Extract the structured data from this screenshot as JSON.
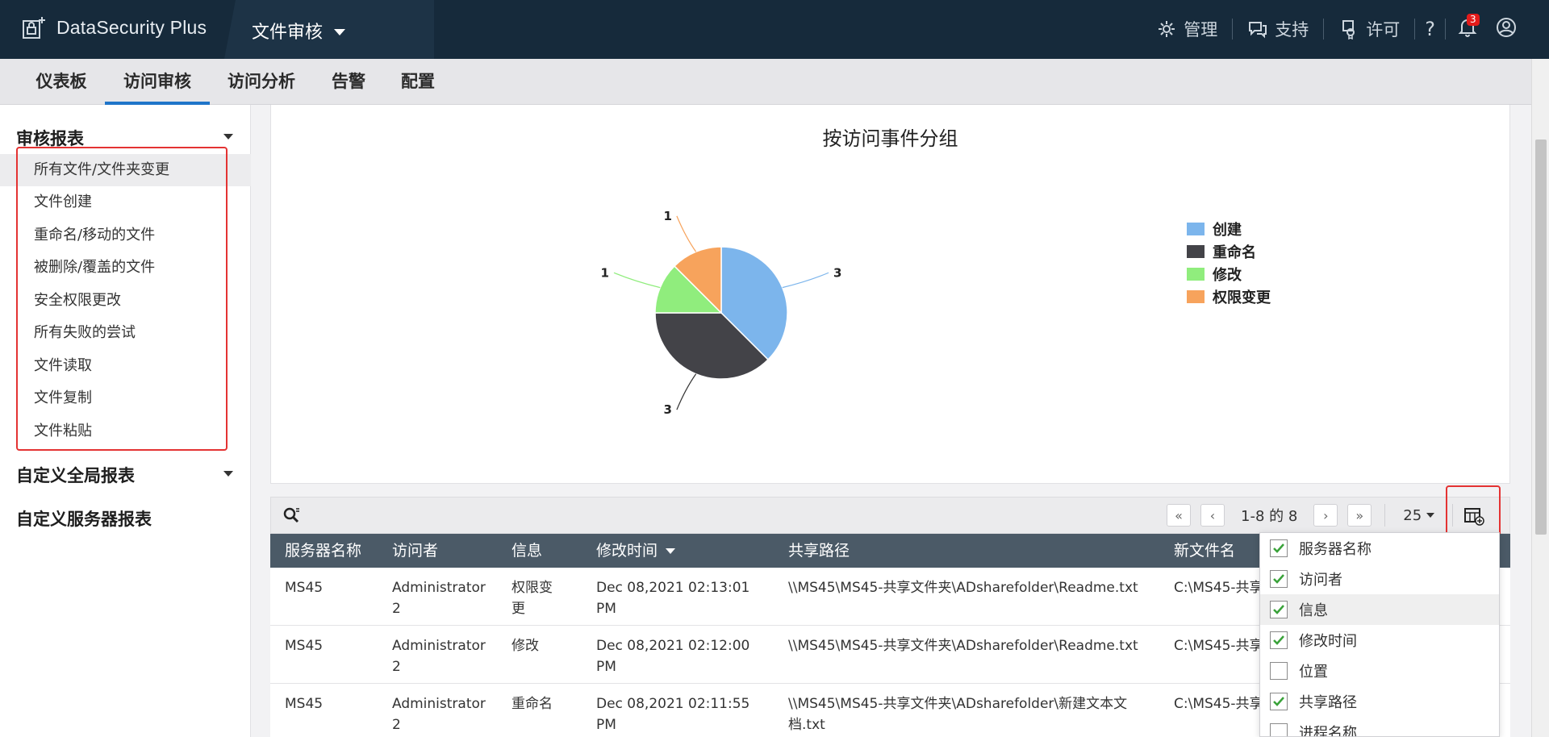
{
  "brand": {
    "name": "DataSecurity Plus"
  },
  "module": {
    "label": "文件审核"
  },
  "top_actions": {
    "admin": "管理",
    "support": "支持",
    "license": "许可",
    "help": "?",
    "notifications": "3"
  },
  "nav": {
    "tabs": [
      "仪表板",
      "访问审核",
      "访问分析",
      "告警",
      "配置"
    ],
    "active": "访问审核"
  },
  "sidebar": {
    "audit_reports": "审核报表",
    "items": [
      "所有文件/文件夹变更",
      "文件创建",
      "重命名/移动的文件",
      "被删除/覆盖的文件",
      "安全权限更改",
      "所有失败的尝试",
      "文件读取",
      "文件复制",
      "文件粘贴"
    ],
    "custom_global": "自定义全局报表",
    "custom_server": "自定义服务器报表"
  },
  "chart_data": {
    "type": "pie",
    "title": "按访问事件分组",
    "categories": [
      "创建",
      "重命名",
      "修改",
      "权限变更"
    ],
    "values": [
      3,
      3,
      1,
      1
    ],
    "colors": [
      "#7cb5ec",
      "#434348",
      "#90ed7d",
      "#f7a35c"
    ],
    "legend": "right"
  },
  "pager": {
    "range": "1-8 的 8",
    "per_page": "25",
    "first": "«",
    "prev": "‹",
    "next": "›",
    "last": "»"
  },
  "table": {
    "headers": [
      "服务器名称",
      "访问者",
      "信息",
      "修改时间",
      "共享路径",
      "新文件名"
    ],
    "rows": [
      {
        "server": "MS45",
        "user_line1": "Administrator",
        "user_line2": "2",
        "info_line1": "权限变",
        "info_line2": "更",
        "time_line1": "Dec 08,2021 02:13:01",
        "time_line2": "PM",
        "path_line1": "\\\\MS45\\MS45-共享文件夹\\ADsharefolder\\Readme.txt",
        "path_line2": "",
        "newname": "C:\\MS45-共享"
      },
      {
        "server": "MS45",
        "user_line1": "Administrator",
        "user_line2": "2",
        "info_line1": "修改",
        "info_line2": "",
        "time_line1": "Dec 08,2021 02:12:00",
        "time_line2": "PM",
        "path_line1": "\\\\MS45\\MS45-共享文件夹\\ADsharefolder\\Readme.txt",
        "path_line2": "",
        "newname": "C:\\MS45-共享"
      },
      {
        "server": "MS45",
        "user_line1": "Administrator",
        "user_line2": "2",
        "info_line1": "重命名",
        "info_line2": "",
        "time_line1": "Dec 08,2021 02:11:55",
        "time_line2": "PM",
        "path_line1": "\\\\MS45\\MS45-共享文件夹\\ADsharefolder\\新建文本文",
        "path_line2": "档.txt",
        "newname": "C:\\MS45-共享"
      }
    ]
  },
  "column_chooser": {
    "options": [
      {
        "label": "服务器名称",
        "checked": true
      },
      {
        "label": "访问者",
        "checked": true
      },
      {
        "label": "信息",
        "checked": true
      },
      {
        "label": "修改时间",
        "checked": true
      },
      {
        "label": "位置",
        "checked": false
      },
      {
        "label": "共享路径",
        "checked": true
      },
      {
        "label": "进程名称",
        "checked": false
      }
    ]
  }
}
